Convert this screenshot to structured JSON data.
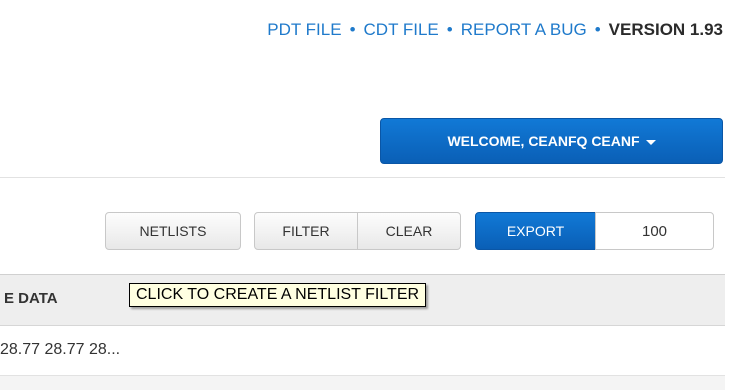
{
  "topnav": {
    "links": [
      "PDT FILE",
      "CDT FILE",
      "REPORT A BUG"
    ],
    "separator": "•",
    "version": "VERSION 1.93"
  },
  "user_menu": {
    "label": "WELCOME, CEANFQ CEANF"
  },
  "toolbar": {
    "netlists_label": "NETLISTS",
    "filter_label": "FILTER",
    "clear_label": "CLEAR",
    "export_label": "EXPORT",
    "page_size": "100"
  },
  "table": {
    "header": "E DATA",
    "cell": "28.77 28.77 28..."
  },
  "tooltip": {
    "text": "CLICK TO CREATE A NETLIST FILTER"
  },
  "colors": {
    "link": "#1f7acb",
    "primary": "#0a6fcf",
    "tooltip_bg": "#ffffe1"
  }
}
